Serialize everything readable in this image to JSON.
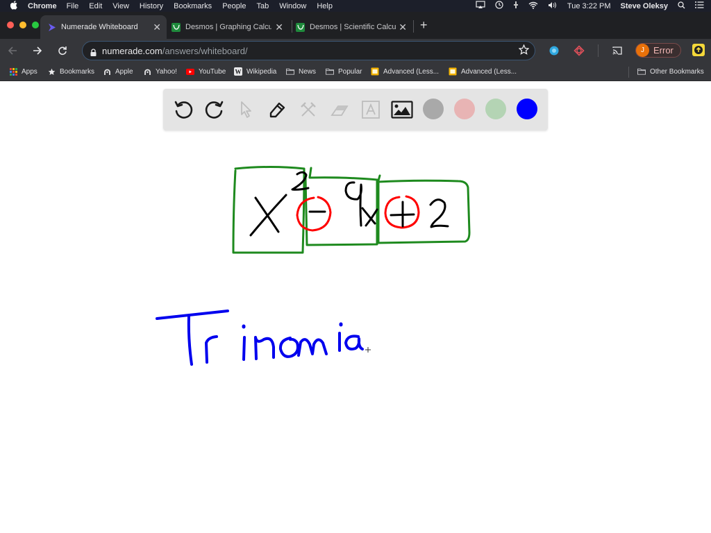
{
  "menubar": {
    "app_name": "Chrome",
    "items": [
      "File",
      "Edit",
      "View",
      "History",
      "Bookmarks",
      "People",
      "Tab",
      "Window",
      "Help"
    ],
    "clock": "Tue 3:22 PM",
    "user": "Steve Oleksy"
  },
  "tabs": [
    {
      "title": "Numerade Whiteboard",
      "active": true,
      "icon": "numerade-logo-icon"
    },
    {
      "title": "Desmos | Graphing Calculat",
      "active": false,
      "icon": "desmos-logo-icon"
    },
    {
      "title": "Desmos | Scientific Calculat",
      "active": false,
      "icon": "desmos-logo-icon"
    }
  ],
  "toolbar": {
    "url_host": "numerade.com",
    "url_path": "/answers/whiteboard/",
    "profile_initial": "J",
    "profile_status": "Error"
  },
  "bookmarks": {
    "items": [
      {
        "label": "Apps",
        "icon": "apps-grid-icon"
      },
      {
        "label": "Bookmarks",
        "icon": "star-icon"
      },
      {
        "label": "Apple",
        "icon": "globe-icon"
      },
      {
        "label": "Yahoo!",
        "icon": "globe-icon"
      },
      {
        "label": "YouTube",
        "icon": "youtube-icon"
      },
      {
        "label": "Wikipedia",
        "icon": "wikipedia-icon"
      },
      {
        "label": "News",
        "icon": "folder-icon"
      },
      {
        "label": "Popular",
        "icon": "folder-icon"
      },
      {
        "label": "Advanced (Less...",
        "icon": "slides-icon"
      },
      {
        "label": "Advanced (Less...",
        "icon": "slides-icon"
      }
    ],
    "other": "Other Bookmarks"
  },
  "whiteboard": {
    "tools": [
      {
        "name": "undo",
        "enabled": true
      },
      {
        "name": "redo",
        "enabled": true
      },
      {
        "name": "select",
        "enabled": false
      },
      {
        "name": "pen",
        "enabled": true
      },
      {
        "name": "tools",
        "enabled": false
      },
      {
        "name": "eraser",
        "enabled": false
      },
      {
        "name": "text",
        "enabled": false
      },
      {
        "name": "image",
        "enabled": true
      }
    ],
    "colors": [
      {
        "name": "gray",
        "hex": "#a9a9a9"
      },
      {
        "name": "pink",
        "hex": "#e8b4b4"
      },
      {
        "name": "green",
        "hex": "#b4d4b4"
      },
      {
        "name": "blue",
        "hex": "#0000ff"
      }
    ],
    "drawing": {
      "expression": "x^2 - 9x + 2",
      "label": "Trinomia",
      "ink_colors": {
        "black": "#000000",
        "green": "#1e8a1e",
        "red": "#ff0000",
        "blue": "#0000ee"
      }
    }
  }
}
